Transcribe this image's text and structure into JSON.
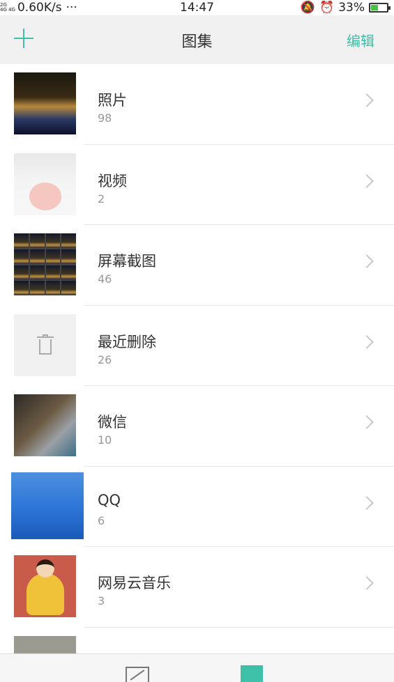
{
  "status_bar": {
    "network_top": "2G",
    "network_mid": "4G 4G",
    "speed": "0.60K/s",
    "more": "···",
    "time": "14:47",
    "battery": "33%"
  },
  "header": {
    "title": "图集",
    "edit_label": "编辑"
  },
  "albums": [
    {
      "name": "照片",
      "count": "98"
    },
    {
      "name": "视频",
      "count": "2"
    },
    {
      "name": "屏幕截图",
      "count": "46"
    },
    {
      "name": "最近删除",
      "count": "26"
    },
    {
      "name": "微信",
      "count": "10"
    },
    {
      "name": "QQ",
      "count": "6"
    },
    {
      "name": "网易云音乐",
      "count": "3"
    }
  ],
  "icons": {
    "add": "plus-icon",
    "chevron": "chevron-right-icon",
    "trash": "trash-icon",
    "nav_photos": "photos-icon",
    "nav_albums": "albums-icon"
  },
  "colors": {
    "accent": "#3dbfa8",
    "header_bg": "#f0f0f0"
  }
}
